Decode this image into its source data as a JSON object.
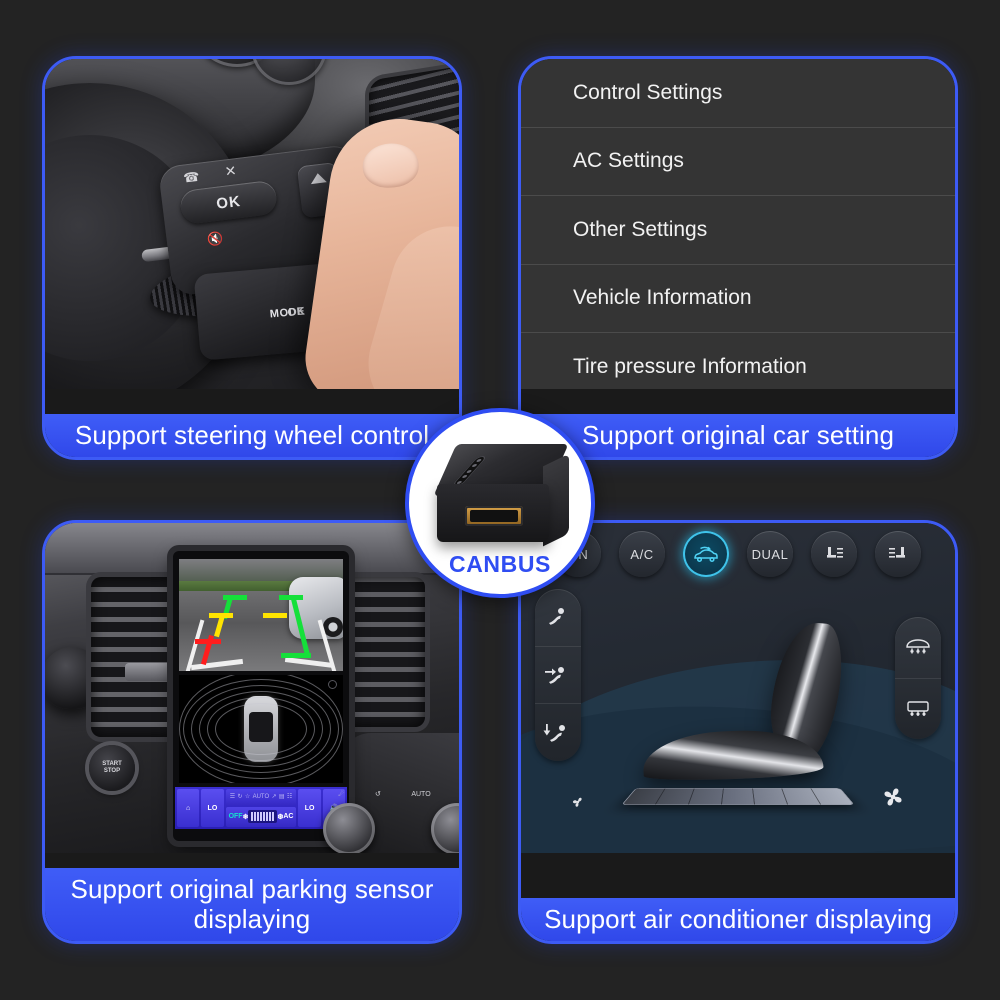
{
  "theme": {
    "background": "#232323",
    "accent_blue": "#3d5bf5",
    "caption_blue": "#3f5df7",
    "active_cyan": "#3fc3ea",
    "badge_text_blue": "#2f4df2"
  },
  "center_badge": {
    "label": "CANBUS",
    "icon": "canbus-module-icon"
  },
  "cards": [
    {
      "id": "steering-wheel",
      "caption": "Support steering wheel control",
      "photo_labels": {
        "ok_button": "OK",
        "mode_ok_stalk": "MODE\nOK",
        "mode_label_line1": "MODE",
        "mode_label_line2": "OK"
      }
    },
    {
      "id": "original-car-setting",
      "caption": "Support original car setting",
      "settings_menu": [
        "Control Settings",
        "AC Settings",
        "Other Settings",
        "Vehicle Information",
        "Tire pressure Information"
      ]
    },
    {
      "id": "parking-sensor",
      "caption": "Support original parking sensor displaying",
      "climate_strip": {
        "left_temp": "LO",
        "right_temp": "LO",
        "mode": "OFF",
        "ac_label": "AC",
        "auto_label": "AUTO",
        "fan_bars": 8
      },
      "start_stop_label": "START\nSTOP",
      "guide_line_colors": [
        "#ff1d1d",
        "#ffe400",
        "#15e03a"
      ]
    },
    {
      "id": "air-conditioner",
      "caption": "Support air conditioner displaying",
      "top_buttons": [
        {
          "label": "ON",
          "icon": "power-on-button",
          "active": false
        },
        {
          "label": "A/C",
          "icon": "ac-button",
          "active": false
        },
        {
          "label": "",
          "icon": "recirculation-car-icon",
          "active": true
        },
        {
          "label": "DUAL",
          "icon": "dual-zone-button",
          "active": false
        },
        {
          "label": "",
          "icon": "seat-heater-left-icon",
          "active": false
        },
        {
          "label": "",
          "icon": "seat-heater-right-icon",
          "active": false
        }
      ],
      "left_pill_icons": [
        "airflow-face-icon",
        "airflow-body-icon",
        "airflow-feet-icon"
      ],
      "right_pill_icons": [
        "front-defrost-icon",
        "rear-defog-icon"
      ],
      "fan_icons": [
        "fan-low-icon",
        "fan-high-icon"
      ],
      "fan_bar_segments": 7
    }
  ]
}
